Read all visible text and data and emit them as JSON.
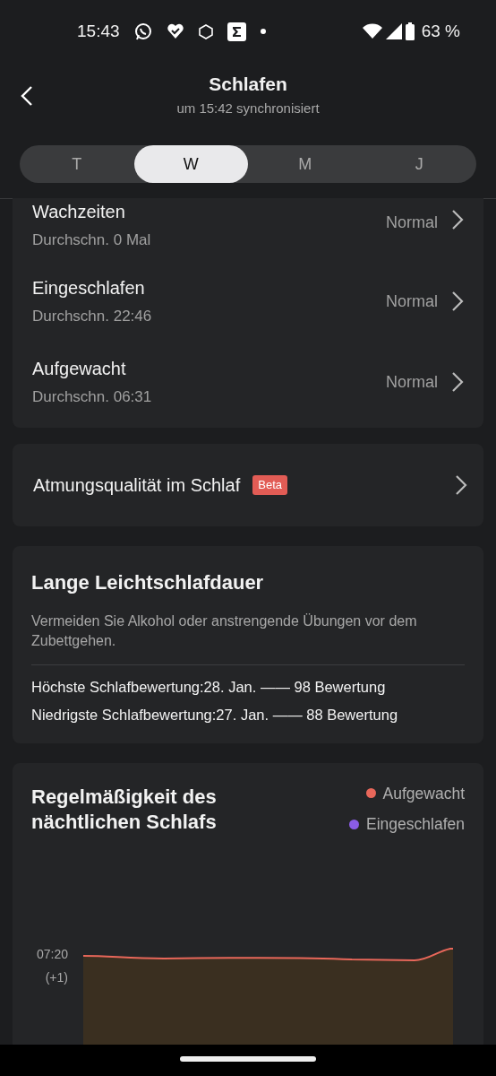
{
  "status_bar": {
    "time": "15:43",
    "battery": "63 %"
  },
  "header": {
    "title": "Schlafen",
    "subtitle": "um 15:42 synchronisiert"
  },
  "tabs": [
    {
      "label": "T",
      "selected": false
    },
    {
      "label": "W",
      "selected": true
    },
    {
      "label": "M",
      "selected": false
    },
    {
      "label": "J",
      "selected": false
    }
  ],
  "stats": [
    {
      "title": "Wachzeiten",
      "detail": "Durchschn. 0 Mal",
      "status": "Normal"
    },
    {
      "title": "Eingeschlafen",
      "detail": "Durchschn. 22:46",
      "status": "Normal"
    },
    {
      "title": "Aufgewacht",
      "detail": "Durchschn. 06:31",
      "status": "Normal"
    }
  ],
  "breathing": {
    "label": "Atmungsqualität im Schlaf",
    "badge": "Beta"
  },
  "advice": {
    "title": "Lange Leichtschlafdauer",
    "text": "Vermeiden Sie Alkohol oder anstrengende Übungen vor dem Zubettgehen.",
    "records": [
      "Höchste Schlafbewertung:28. Jan. —— 98 Bewertung",
      "Niedrigste Schlafbewertung:27. Jan. —— 88 Bewertung"
    ]
  },
  "regularity": {
    "title": "Regelmäßigkeit des nächtlichen Schlafs",
    "legend": [
      {
        "label": "Aufgewacht",
        "color": "#e8675a"
      },
      {
        "label": "Eingeschlafen",
        "color": "#8a5ce6"
      }
    ],
    "axis_label": [
      "07:20",
      "(+1)"
    ]
  }
}
